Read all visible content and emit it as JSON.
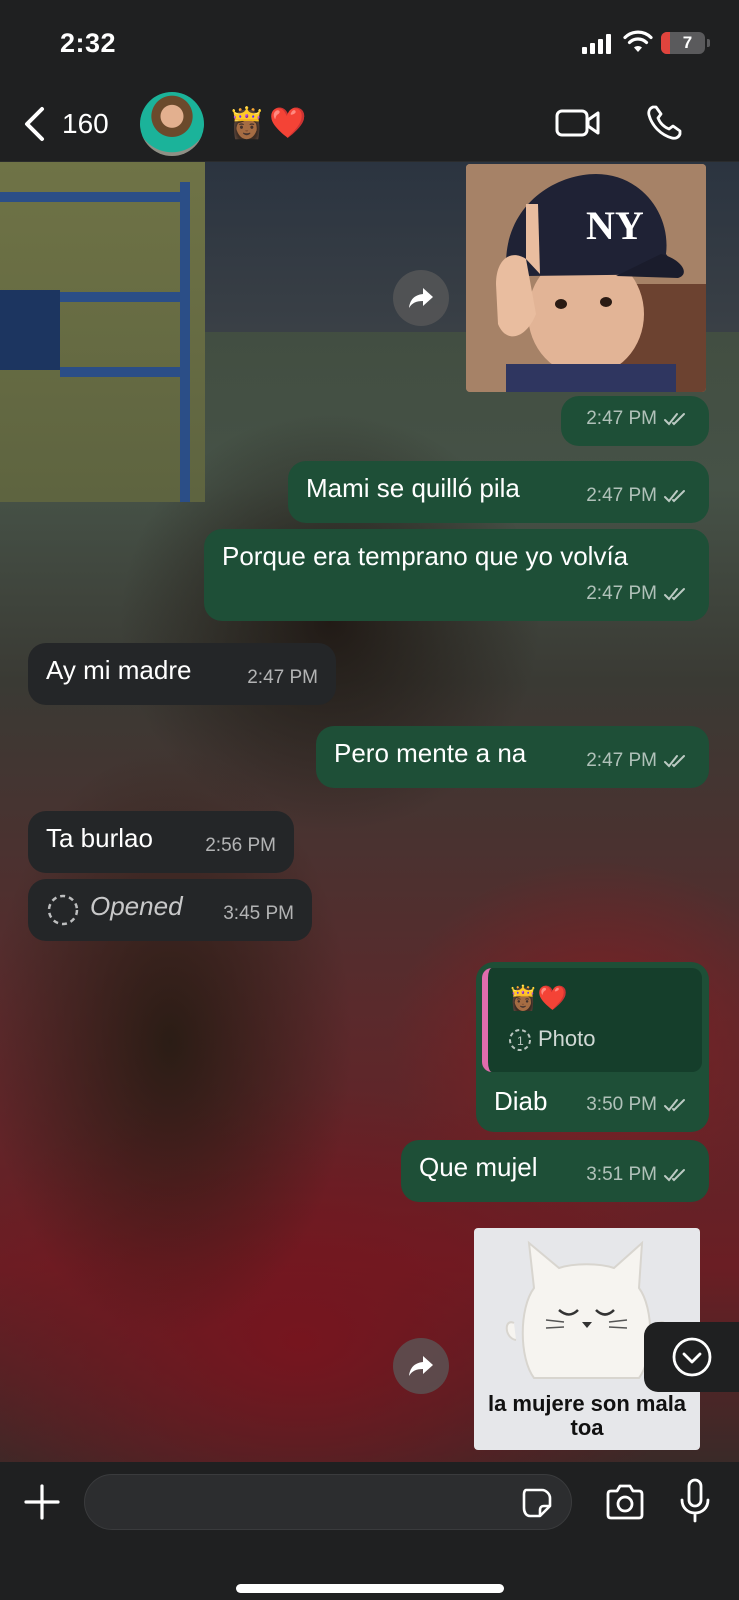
{
  "status": {
    "time": "2:32",
    "battery": "7"
  },
  "header": {
    "back_count": "160",
    "contact_name": "👸🏾❤️"
  },
  "messages": [
    {
      "id": "m1",
      "type": "image",
      "direction": "out",
      "time": "2:47 PM"
    },
    {
      "id": "m2",
      "text": "Mami se quilló pila",
      "time": "2:47 PM",
      "direction": "out"
    },
    {
      "id": "m3",
      "text": "Porque era temprano que yo volvía",
      "time": "2:47 PM",
      "direction": "out"
    },
    {
      "id": "m4",
      "text": "Ay mi madre",
      "time": "2:47 PM",
      "direction": "in"
    },
    {
      "id": "m5",
      "text": "Pero mente a na",
      "time": "2:47 PM",
      "direction": "out"
    },
    {
      "id": "m6",
      "text": "Ta burlao",
      "time": "2:56 PM",
      "direction": "in"
    },
    {
      "id": "m7",
      "text": "Opened",
      "time": "3:45 PM",
      "direction": "in",
      "view_once": true
    },
    {
      "id": "m8",
      "reply_to_name": "👸🏾❤️",
      "reply_to_label": "Photo",
      "text": "Diab",
      "time": "3:50 PM",
      "direction": "out"
    },
    {
      "id": "m9",
      "text": "Que mujel",
      "time": "3:51 PM",
      "direction": "out"
    },
    {
      "id": "m10",
      "type": "sticker",
      "direction": "out",
      "caption": "la mujere son mala toa"
    }
  ],
  "colors": {
    "outgoing": "#1e4f37",
    "incoming": "#242628",
    "reply_accent": "#e06cad"
  }
}
